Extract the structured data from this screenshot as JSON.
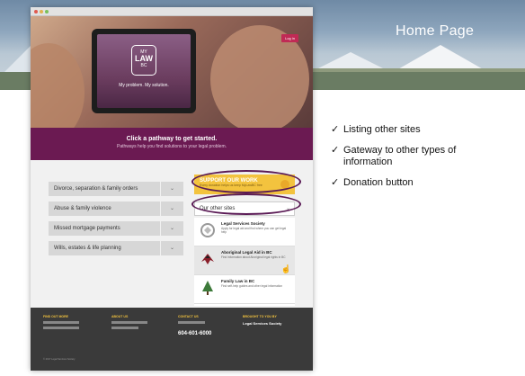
{
  "slide": {
    "title": "Home Page"
  },
  "bullets": [
    {
      "icon": "checkmark-icon",
      "text": "Listing other sites"
    },
    {
      "icon": "checkmark-icon",
      "text": "Gateway to other types of information"
    },
    {
      "icon": "checkmark-icon",
      "text": "Donation button"
    }
  ],
  "site": {
    "login_label": "Log in",
    "logo": {
      "top": "MY",
      "main": "LAW",
      "bottom": "BC"
    },
    "tagline": "My problem. My solution.",
    "pathways": {
      "title": "Click a pathway to get started.",
      "subtitle": "Pathways help you find solutions to your legal problem."
    },
    "pathway_items": [
      {
        "label": "Divorce, separation & family orders"
      },
      {
        "label": "Abuse & family violence"
      },
      {
        "label": "Missed mortgage payments"
      },
      {
        "label": "Wills, estates & life planning"
      }
    ],
    "support": {
      "title": "SUPPORT OUR WORK",
      "text": "Every donation helps us keep MyLawBC free"
    },
    "other_sites": {
      "label": "Our other sites"
    },
    "other_site_items": [
      {
        "name": "Legal Services Society",
        "desc": "Apply for legal aid and find where you can get legal help",
        "icon": "lss-icon"
      },
      {
        "name": "Aboriginal Legal Aid in BC",
        "desc": "Find information about Aboriginal legal rights in BC",
        "icon": "eagle-icon"
      },
      {
        "name": "Family Law in BC",
        "desc": "Find self-help guides and other legal information",
        "icon": "tree-icon"
      }
    ],
    "footer": {
      "find_out_more": "FIND OUT MORE",
      "about_us": "ABOUT US",
      "contact_us": "CONTACT US",
      "phone": "604-601-6000",
      "brought": "BROUGHT TO YOU BY",
      "lss": "Legal Services Society",
      "copyright": "© 2017 Legal Services Society"
    }
  },
  "colors": {
    "accent": "#6b1a52",
    "donate": "#f3c33e"
  }
}
